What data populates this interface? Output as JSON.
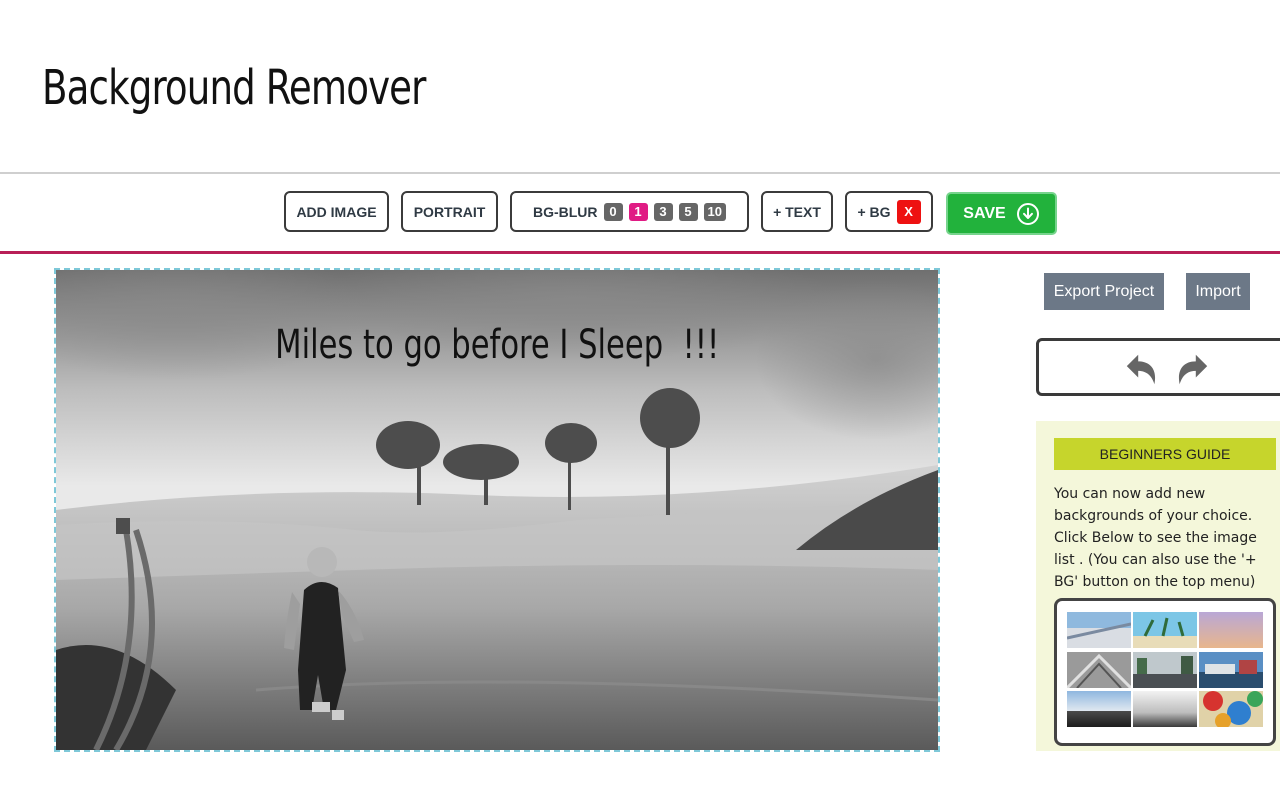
{
  "header": {
    "title": "Background Remover"
  },
  "toolbar": {
    "add_image": "ADD IMAGE",
    "portrait": "PORTRAIT",
    "bg_blur_label": "BG-BLUR",
    "bg_blur_options": [
      "0",
      "1",
      "3",
      "5",
      "10"
    ],
    "bg_blur_selected": "1",
    "add_text": "+ TEXT",
    "add_bg": "+ BG",
    "remove_bg": "X",
    "save": "SAVE"
  },
  "canvas": {
    "overlay_text": "Miles to go before I Sleep  !!!",
    "border_color": "#7ec8d8"
  },
  "side": {
    "export_label": "Export Project",
    "import_label": "Import"
  },
  "guide": {
    "heading": "BEGINNERS GUIDE",
    "text": "You can now add new backgrounds of your choice. Click Below to see the image list . (You can also use the '+ BG' button on the top menu)"
  },
  "colors": {
    "accent_line": "#b81f57",
    "blur_active": "#e01b84",
    "save_green": "#22b23c",
    "guide_header": "#c6d52c",
    "guide_bg": "#f4f7da",
    "side_button": "#6c7887"
  },
  "icons": {
    "undo": "undo-icon",
    "redo": "redo-icon",
    "save": "download-circle-icon"
  }
}
